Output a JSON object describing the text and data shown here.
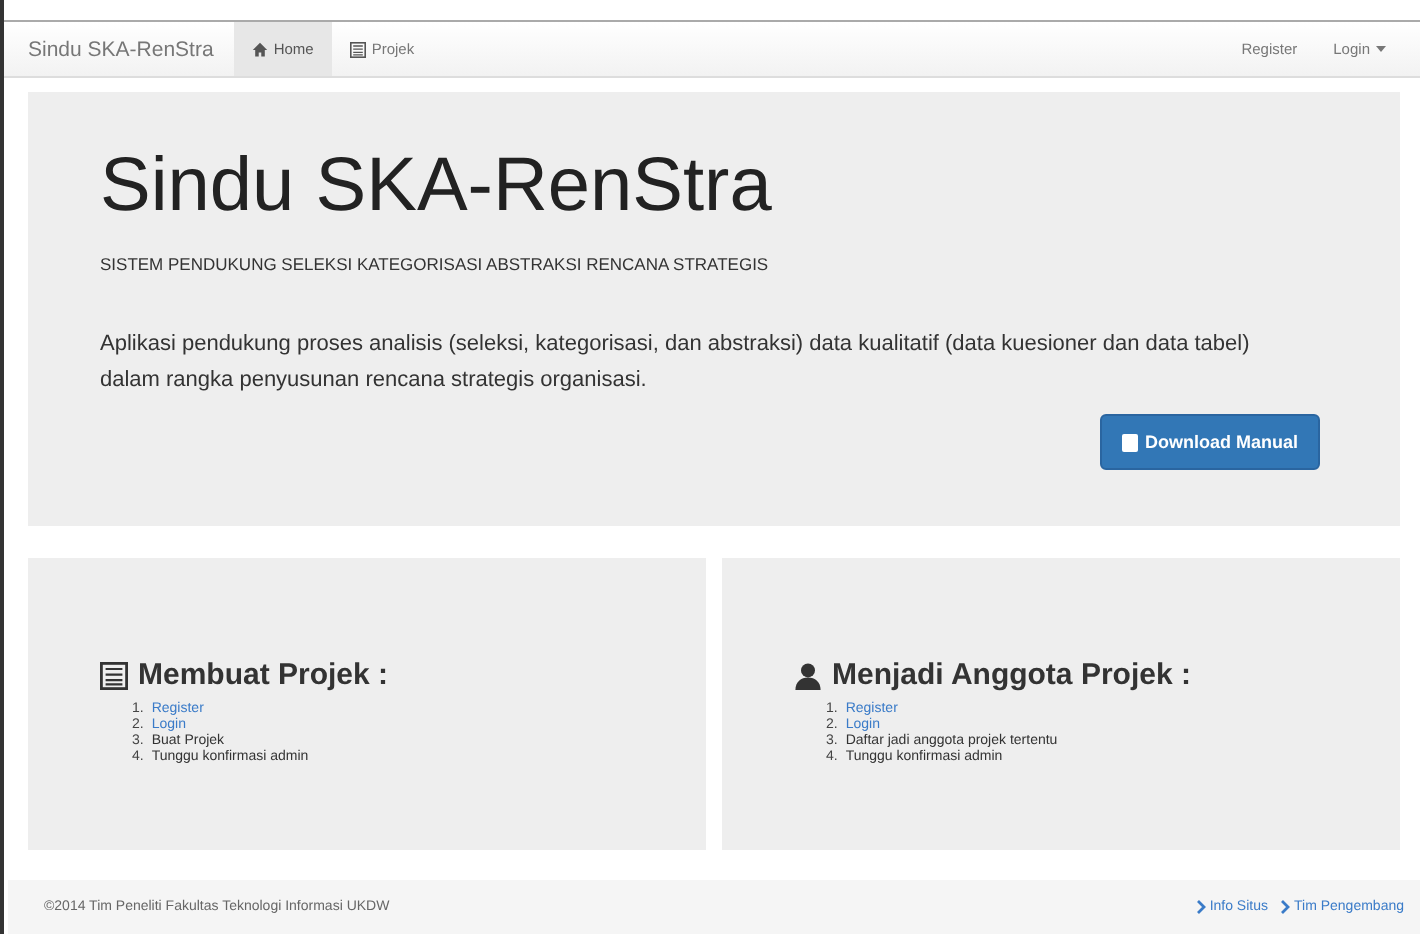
{
  "navbar": {
    "brand": "Sindu SKA-RenStra",
    "nav_items": [
      {
        "label": "Home",
        "kind": "home",
        "selected": true
      },
      {
        "label": "Projek",
        "kind": "list",
        "selected": false
      }
    ],
    "right_items": [
      {
        "label": "Register",
        "dropdown": false
      },
      {
        "label": "Login",
        "dropdown": true
      }
    ]
  },
  "hero": {
    "title": "Sindu SKA-RenStra",
    "subtitle": "SISTEM PENDUKUNG SELEKSI KATEGORISASI ABSTRAKSI RENCANA STRATEGIS",
    "description": "Aplikasi pendukung proses analisis (seleksi, kategorisasi, dan abstraksi) data kualitatif (data kuesioner dan data tabel) dalam rangka penyusunan rencana strategis organisasi.",
    "button": "Download Manual"
  },
  "panels": [
    {
      "title": "Membuat Projek :",
      "kind": "list",
      "steps": [
        {
          "number": "1.",
          "text": "Register",
          "kind": "link"
        },
        {
          "number": "2.",
          "text": "Login",
          "kind": "link"
        },
        {
          "number": "3.",
          "text": "Buat Projek",
          "kind": "text"
        },
        {
          "number": "4.",
          "text": "Tunggu konfirmasi admin",
          "kind": "text"
        }
      ]
    },
    {
      "title": "Menjadi Anggota Projek :",
      "kind": "user",
      "steps": [
        {
          "number": "1.",
          "text": "Register",
          "kind": "link"
        },
        {
          "number": "2.",
          "text": "Login",
          "kind": "link"
        },
        {
          "number": "3.",
          "text": "Daftar jadi anggota projek tertentu",
          "kind": "text"
        },
        {
          "number": "4.",
          "text": "Tunggu konfirmasi admin",
          "kind": "text"
        }
      ]
    }
  ],
  "footer": {
    "copyright": "©2014 Tim Peneliti Fakultas Teknologi Informasi UKDW",
    "links": [
      "Info Situs",
      "Tim Pengembang"
    ]
  }
}
